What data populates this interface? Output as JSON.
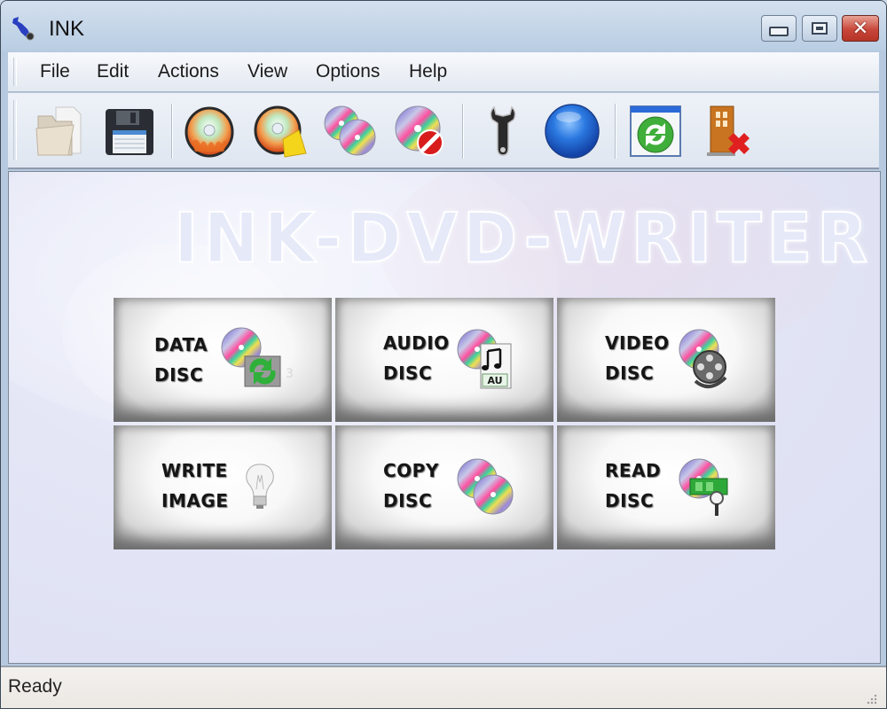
{
  "window": {
    "title": "INK",
    "controls": {
      "minimize": "minimize",
      "maximize": "maximize",
      "close": "✕"
    }
  },
  "menu": {
    "items": [
      {
        "label": "File"
      },
      {
        "label": "Edit"
      },
      {
        "label": "Actions"
      },
      {
        "label": "View"
      },
      {
        "label": "Options"
      },
      {
        "label": "Help"
      }
    ]
  },
  "toolbar": {
    "buttons": [
      {
        "icon": "open-folder-icon",
        "tooltip": "Open"
      },
      {
        "icon": "floppy-save-icon",
        "tooltip": "Save"
      },
      {
        "icon": "burn-disc-icon",
        "tooltip": "Burn"
      },
      {
        "icon": "burn-disc-arrow-icon",
        "tooltip": "Burn to"
      },
      {
        "icon": "copy-discs-icon",
        "tooltip": "Copy disc"
      },
      {
        "icon": "erase-disc-icon",
        "tooltip": "Erase disc"
      },
      {
        "icon": "wrench-icon",
        "tooltip": "Settings"
      },
      {
        "icon": "blue-sphere-icon",
        "tooltip": "Web"
      },
      {
        "icon": "refresh-window-icon",
        "tooltip": "Refresh"
      },
      {
        "icon": "exit-door-icon",
        "tooltip": "Exit"
      }
    ]
  },
  "banner": {
    "text": "INK-DVD-WRITER"
  },
  "tiles": [
    {
      "line1": "DATA",
      "line2": "DISC",
      "icon": "data-disc-icon"
    },
    {
      "line1": "AUDIO",
      "line2": "DISC",
      "icon": "audio-disc-icon",
      "badge": "AU"
    },
    {
      "line1": "VIDEO",
      "line2": "DISC",
      "icon": "video-disc-icon"
    },
    {
      "line1": "WRITE",
      "line2": "IMAGE",
      "icon": "lightbulb-icon"
    },
    {
      "line1": "COPY",
      "line2": "DISC",
      "icon": "copy-disc-icon"
    },
    {
      "line1": "READ",
      "line2": "DISC",
      "icon": "read-disc-icon"
    }
  ],
  "status": {
    "text": "Ready"
  },
  "colors": {
    "titlebar": "#b9cde3",
    "close_button": "#c8473a",
    "main_background": "#e4e6f6",
    "statusbar": "#f0eee9"
  }
}
